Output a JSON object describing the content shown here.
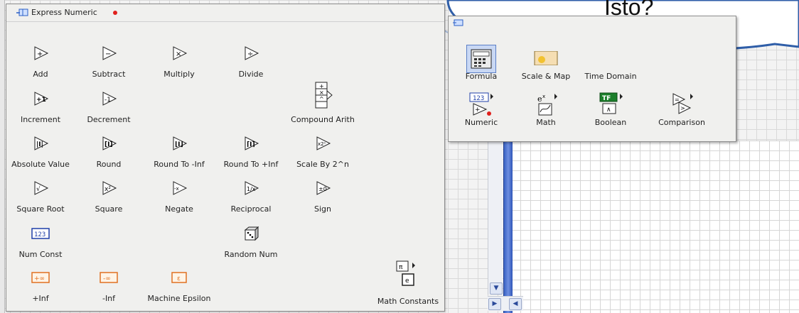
{
  "palette": {
    "title": "Express Numeric",
    "items": [
      {
        "label": "Add",
        "icon": "add-icon"
      },
      {
        "label": "Subtract",
        "icon": "subtract-icon"
      },
      {
        "label": "Multiply",
        "icon": "multiply-icon"
      },
      {
        "label": "Divide",
        "icon": "divide-icon"
      },
      {
        "label": "Increment",
        "icon": "increment-icon"
      },
      {
        "label": "Decrement",
        "icon": "decrement-icon"
      },
      {
        "label": "Compound Arith",
        "icon": "compound-arith-icon"
      },
      {
        "label": "Absolute Value",
        "icon": "absolute-value-icon"
      },
      {
        "label": "Round",
        "icon": "round-icon"
      },
      {
        "label": "Round To -Inf",
        "icon": "round-to-neg-inf-icon"
      },
      {
        "label": "Round To +Inf",
        "icon": "round-to-pos-inf-icon"
      },
      {
        "label": "Scale By 2^n",
        "icon": "scale-by-power-of-2-icon"
      },
      {
        "label": "Square Root",
        "icon": "square-root-icon"
      },
      {
        "label": "Square",
        "icon": "square-icon"
      },
      {
        "label": "Negate",
        "icon": "negate-icon"
      },
      {
        "label": "Reciprocal",
        "icon": "reciprocal-icon"
      },
      {
        "label": "Sign",
        "icon": "sign-icon"
      },
      {
        "label": "Num Const",
        "icon": "numeric-constant-icon",
        "icon_text": "123"
      },
      {
        "label": "Random Num",
        "icon": "random-number-dice-icon"
      },
      {
        "label": "+Inf",
        "icon": "positive-infinity-icon",
        "icon_text": "+∞"
      },
      {
        "label": "-Inf",
        "icon": "negative-infinity-icon",
        "icon_text": "-∞"
      },
      {
        "label": "Machine Epsilon",
        "icon": "machine-epsilon-icon",
        "icon_text": "ε"
      },
      {
        "label": "Math Constants",
        "icon": "math-constants-icon"
      }
    ]
  },
  "sub_palette": {
    "items": [
      {
        "label": "Formula",
        "icon": "formula-calculator-icon"
      },
      {
        "label": "Scale & Map",
        "icon": "scale-map-icon"
      },
      {
        "label": "Time Domain",
        "icon": "time-domain-icon"
      },
      {
        "label": "Numeric",
        "icon": "numeric-icon",
        "icon_text": "123"
      },
      {
        "label": "Math",
        "icon": "math-icon"
      },
      {
        "label": "Boolean",
        "icon": "boolean-icon",
        "icon_text": "TF"
      },
      {
        "label": "Comparison",
        "icon": "comparison-icon"
      }
    ]
  },
  "bubble": {
    "text": "Isto?"
  },
  "colors": {
    "accent_blue": "#3a63c4",
    "numeric_blue": "#1f3fa8",
    "infinity_orange": "#e07020",
    "status_red": "#e0201c"
  }
}
